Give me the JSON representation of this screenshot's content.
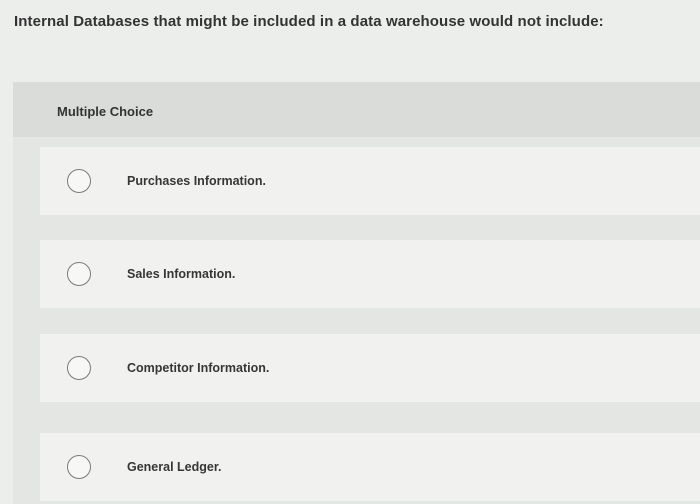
{
  "question": {
    "text": "Internal Databases that might be included in a data warehouse would not include:"
  },
  "panel": {
    "header": "Multiple Choice"
  },
  "options": [
    {
      "label": "Purchases Information."
    },
    {
      "label": "Sales Information."
    },
    {
      "label": "Competitor Information."
    },
    {
      "label": "General Ledger."
    }
  ],
  "colors": {
    "page_background": "#eceeec",
    "panel_background": "#e4e6e4",
    "option_background": "#f1f2f0",
    "radio_border": "#7a7c7a"
  }
}
